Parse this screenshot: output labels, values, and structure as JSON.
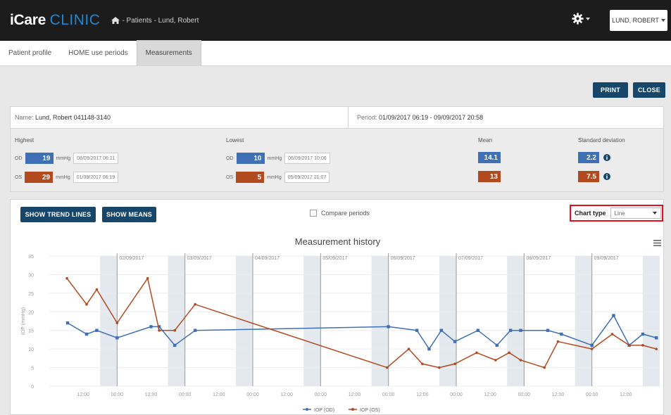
{
  "app": {
    "brand_a": "iCare",
    "brand_b": "CLINIC",
    "breadcrumb": "- Patients - Lund, Robert",
    "user": "LUND, ROBERT",
    "icons": {
      "home": "home-icon",
      "settings": "gear-icon",
      "caret": "caret-down-icon"
    }
  },
  "tabs": [
    {
      "label": "Patient profile",
      "active": false
    },
    {
      "label": "HOME use periods",
      "active": false
    },
    {
      "label": "Measurements",
      "active": true
    }
  ],
  "actions": {
    "print": "PRINT",
    "close": "CLOSE"
  },
  "patient": {
    "name_label": "Name:",
    "name": "Lund, Robert 041148-3140",
    "period_label": "Period:",
    "period": "01/09/2017 06:19 - 09/09/2017 20:58"
  },
  "stats": {
    "highest": {
      "title": "Highest",
      "od": {
        "eye": "OD",
        "value": "19",
        "unit": "mmHg",
        "date": "08/09/2017 06:11"
      },
      "os": {
        "eye": "OS",
        "value": "29",
        "unit": "mmHg",
        "date": "01/09/2017 06:19"
      }
    },
    "lowest": {
      "title": "Lowest",
      "od": {
        "eye": "OD",
        "value": "10",
        "unit": "mmHg",
        "date": "06/09/2017 10:06"
      },
      "os": {
        "eye": "OS",
        "value": "5",
        "unit": "mmHg",
        "date": "05/09/2017 21:07"
      }
    },
    "mean": {
      "title": "Mean",
      "od": "14.1",
      "os": "13"
    },
    "sd": {
      "title": "Standard deviation",
      "od": "2.2",
      "os": "7.5"
    }
  },
  "controls": {
    "trend": "SHOW TREND LINES",
    "means": "SHOW MEANS",
    "compare": "Compare periods",
    "chart_type_label": "Chart type",
    "chart_type_value": "Line"
  },
  "chart_data": {
    "type": "line",
    "title": "Measurement history",
    "ylabel": "IOP (mmHg)",
    "ylim": [
      0,
      35
    ],
    "yticks": [
      0,
      5,
      10,
      15,
      20,
      25,
      30,
      35
    ],
    "xlim": [
      0,
      9
    ],
    "x_unit": "days from 01/09/2017 00:00",
    "date_labels": [
      "02/09/2017",
      "03/09/2017",
      "04/09/2017",
      "05/09/2017",
      "06/09/2017",
      "07/09/2017",
      "08/09/2017",
      "09/09/2017"
    ],
    "time_ticks": [
      "12:00",
      "00:00",
      "12:00",
      "00:00",
      "12:00",
      "00:00",
      "12:00",
      "00:00",
      "12:00",
      "00:00",
      "12:00",
      "00:00",
      "12:00",
      "00:00",
      "12:00",
      "00:00",
      "12:00"
    ],
    "bands": [
      [
        0.75,
        1.0
      ],
      [
        1.75,
        2.0
      ],
      [
        2.75,
        3.0
      ],
      [
        3.75,
        4.0
      ],
      [
        4.75,
        5.0
      ],
      [
        5.75,
        6.0
      ],
      [
        6.75,
        7.0
      ],
      [
        7.75,
        8.0
      ],
      [
        8.75,
        9.0
      ]
    ],
    "series": [
      {
        "name": "IOP (OD)",
        "color": "#3f6fb5",
        "points": [
          [
            0.27,
            17
          ],
          [
            0.55,
            14
          ],
          [
            0.7,
            15
          ],
          [
            1.0,
            13
          ],
          [
            1.5,
            16
          ],
          [
            1.62,
            16
          ],
          [
            1.85,
            11
          ],
          [
            2.15,
            15
          ],
          [
            5.0,
            16
          ],
          [
            5.42,
            15
          ],
          [
            5.6,
            10
          ],
          [
            5.78,
            15
          ],
          [
            5.98,
            12
          ],
          [
            6.32,
            15
          ],
          [
            6.6,
            11
          ],
          [
            6.8,
            15
          ],
          [
            6.95,
            15
          ],
          [
            7.35,
            15
          ],
          [
            7.55,
            14
          ],
          [
            8.0,
            11
          ],
          [
            8.32,
            19
          ],
          [
            8.55,
            11
          ],
          [
            8.75,
            14
          ],
          [
            8.95,
            13
          ]
        ]
      },
      {
        "name": "IOP (OS)",
        "color": "#b24a1f",
        "points": [
          [
            0.26,
            29
          ],
          [
            0.55,
            22
          ],
          [
            0.7,
            26
          ],
          [
            1.0,
            17
          ],
          [
            1.45,
            29
          ],
          [
            1.62,
            15
          ],
          [
            1.85,
            15
          ],
          [
            2.15,
            22
          ],
          [
            4.98,
            5
          ],
          [
            5.3,
            10
          ],
          [
            5.5,
            6
          ],
          [
            5.75,
            5
          ],
          [
            5.98,
            6
          ],
          [
            6.3,
            9
          ],
          [
            6.58,
            7
          ],
          [
            6.78,
            9
          ],
          [
            6.95,
            7
          ],
          [
            7.3,
            5
          ],
          [
            7.5,
            12
          ],
          [
            8.0,
            10
          ],
          [
            8.3,
            14
          ],
          [
            8.55,
            11
          ],
          [
            8.75,
            11
          ],
          [
            8.95,
            10
          ]
        ]
      }
    ],
    "legend_position": "bottom-center"
  }
}
